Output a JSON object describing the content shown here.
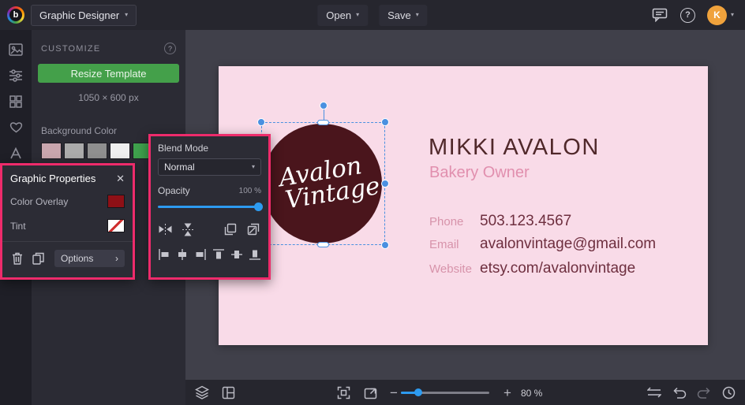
{
  "topbar": {
    "app_switcher_label": "Graphic Designer",
    "open_label": "Open",
    "save_label": "Save",
    "avatar_initial": "K",
    "brand_letter": "b"
  },
  "customize_panel": {
    "title": "CUSTOMIZE",
    "help_glyph": "?",
    "resize_button_label": "Resize Template",
    "canvas_size": "1050 × 600 px",
    "background_color_label": "Background Color",
    "swatches": [
      "#c9a6ae",
      "#ababab",
      "#8f8f8f",
      "#efefef",
      "#3fa24d"
    ]
  },
  "graphic_properties": {
    "title": "Graphic Properties",
    "close_glyph": "✕",
    "color_overlay_label": "Color Overlay",
    "color_overlay_value": "#8e1016",
    "tint_label": "Tint",
    "options_button_label": "Options",
    "options_chevron": "›"
  },
  "blend_panel": {
    "blend_mode_label": "Blend Mode",
    "blend_mode_value": "Normal",
    "opacity_label": "Opacity",
    "opacity_value": "100 %"
  },
  "card": {
    "background": "#f9dbe8",
    "logo": {
      "line1": "Avalon",
      "line2": "Vintage",
      "color": "#4a151c"
    },
    "name": "MIKKI AVALON",
    "role": "Bakery Owner",
    "contacts": [
      {
        "label": "Phone",
        "value": "503.123.4567"
      },
      {
        "label": "Email",
        "value": "avalonvintage@gmail.com"
      },
      {
        "label": "Website",
        "value": "etsy.com/avalonvintage"
      }
    ]
  },
  "bottom_toolbar": {
    "zoom_level": "80 %",
    "minus_glyph": "−",
    "plus_glyph": "+"
  },
  "accents": {
    "highlight": "#ee2b6b",
    "selection_blue": "#4a90e0",
    "slider_blue": "#2d9bf0",
    "green": "#44a04a"
  }
}
